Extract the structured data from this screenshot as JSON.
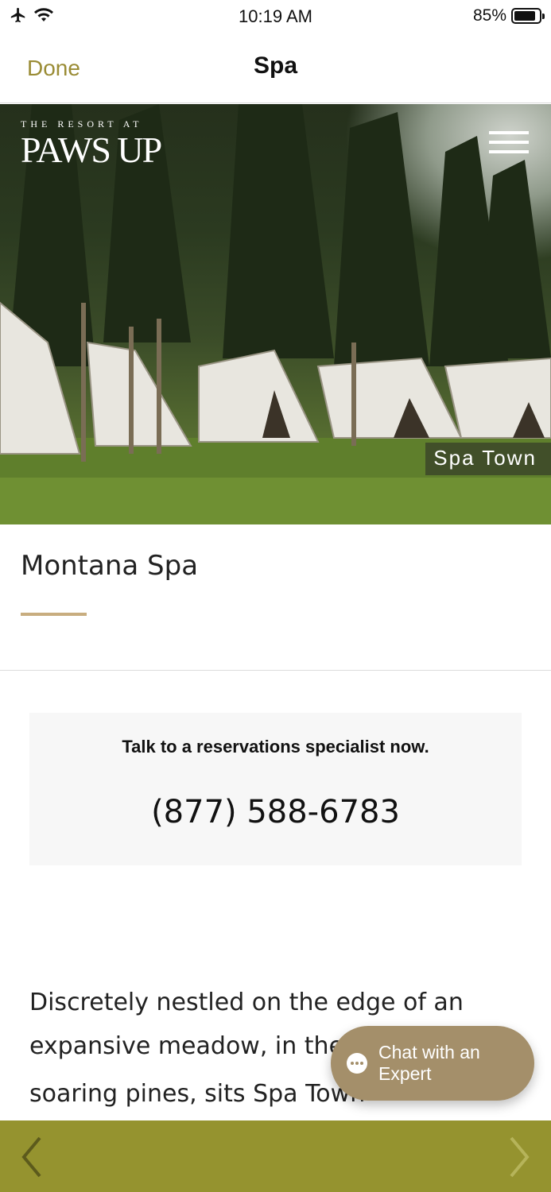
{
  "status_bar": {
    "time": "10:19 AM",
    "battery": "85%",
    "battery_level": 0.85,
    "icons": [
      "airplane-icon",
      "wifi-icon",
      "battery-icon"
    ]
  },
  "nav": {
    "done_label": "Done",
    "title": "Spa"
  },
  "hero": {
    "brand_sub": "THE RESORT AT",
    "brand_main": "PAWS UP",
    "caption": "Spa Town",
    "menu_icon": "hamburger-menu-icon"
  },
  "content": {
    "title": "Montana Spa",
    "accent_color": "#c8ad7f",
    "contact": {
      "label": "Talk to a reservations specialist now.",
      "phone": "(877) 588-6783"
    },
    "body_line1": "Discretely nestled on the edge of an",
    "body_line2": "expansive meadow, in the wo",
    "body_line3": "soaring pines, sits Spa Town",
    "body_reg_mark": "®"
  },
  "chat": {
    "label": "Chat with an Expert",
    "icon": "chat-bubble-icon",
    "color": "#a48f6a"
  },
  "toolbar": {
    "color": "#95932f",
    "back_icon": "chevron-left-icon",
    "forward_icon": "chevron-right-icon"
  }
}
